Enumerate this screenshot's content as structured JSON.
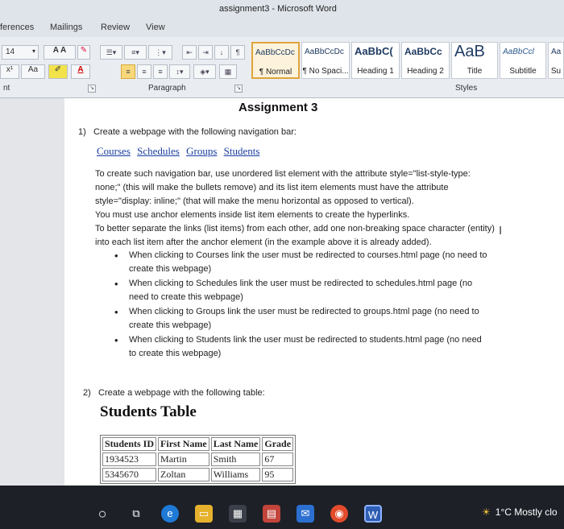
{
  "window": {
    "title": "assignment3 - Microsoft Word"
  },
  "ribbon_tabs": [
    "ferences",
    "Mailings",
    "Review",
    "View"
  ],
  "font_group": {
    "size": "14",
    "grow_label": "A A",
    "case_label": "Aa",
    "superscript_label": "x¹",
    "font_color_label": "A"
  },
  "paragraph_group": {
    "label": "Paragraph"
  },
  "partial_group_label": "nt",
  "styles_group": {
    "label": "Styles",
    "items": [
      {
        "sample": "AaBbCcDc",
        "name": "¶ Normal"
      },
      {
        "sample": "AaBbCcDc",
        "name": "¶ No Spaci..."
      },
      {
        "sample": "AaBbC(",
        "name": "Heading 1"
      },
      {
        "sample": "AaBbCc",
        "name": "Heading 2"
      },
      {
        "sample": "AaB",
        "name": "Title"
      },
      {
        "sample": "AaBbCcl",
        "name": "Subtitle"
      },
      {
        "sample": "Aa",
        "name": "Su"
      }
    ]
  },
  "document": {
    "heading": "Assignment 3",
    "item1": {
      "num": "1)",
      "text": "Create a webpage with the following navigation bar:",
      "links": [
        "Courses",
        "Schedules",
        "Groups",
        "Students"
      ],
      "desc1": "To create such navigation bar, use unordered list element with the attribute style=\"list-style-type: none;\" (this will make the bullets remove) and its list item elements must have the attribute style=\"display: inline;\" (that will make the menu horizontal as opposed to vertical).",
      "desc2": "You must use anchor elements inside list item elements to create the hyperlinks.",
      "desc3": "To better separate the links (list items) from each other, add one non-breaking space character (entity) into each list item after the anchor element (in the example above it is already added).",
      "bullets": [
        "When clicking to Courses link the user must be redirected to courses.html page (no need to create this webpage)",
        "When clicking to Schedules link the user must be redirected to schedules.html page (no need to create this webpage)",
        "When clicking to Groups link the user must be redirected to groups.html page (no need to create this webpage)",
        "When clicking to Students link the user must be redirected to students.html page (no need to create this webpage)"
      ]
    },
    "item2": {
      "num": "2)",
      "text": "Create a webpage with the following table:",
      "table_title": "Students Table",
      "headers": [
        "Students ID",
        "First Name",
        "Last Name",
        "Grade"
      ],
      "rows": [
        [
          "1934523",
          "Martin",
          "Smith",
          "67"
        ],
        [
          "5345670",
          "Zoltan",
          "Williams",
          "95"
        ]
      ]
    }
  },
  "taskbar": {
    "weather": "1°C Mostly clo"
  }
}
